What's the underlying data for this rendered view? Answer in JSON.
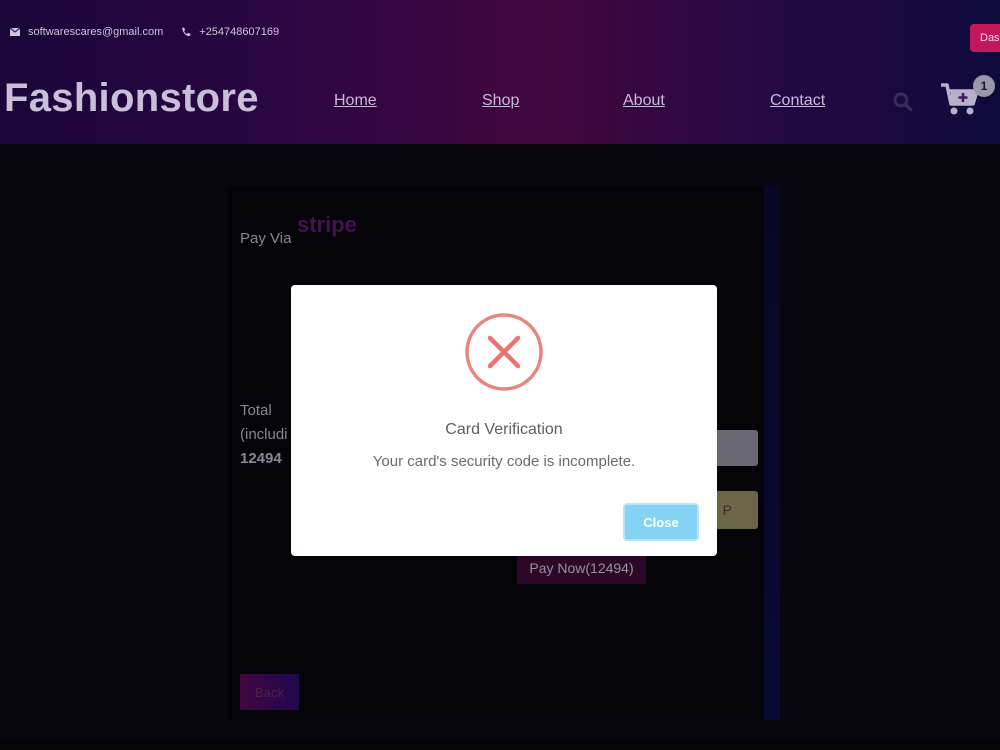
{
  "header": {
    "email": "softwarescares@gmail.com",
    "phone": "+254748607169",
    "dashboard_label": "Das",
    "logo": "Fashionstore",
    "nav": [
      "Home",
      "Shop",
      "About",
      "Contact"
    ],
    "cart_count": "1",
    "icons": [
      "envelope-icon",
      "phone-icon",
      "search-icon",
      "cart-icon"
    ]
  },
  "payment": {
    "pay_via": "Pay Via",
    "provider": "stripe",
    "total_label": "Total",
    "including": "(includi",
    "amount": "12494",
    "pay_field_fragment": "P",
    "pay_now": "Pay Now(12494)",
    "back": "Back"
  },
  "modal": {
    "title": "Card Verification",
    "message": "Your card's security code is incomplete.",
    "close": "Close",
    "icon": "error-x-icon",
    "accent": "#e8857e"
  }
}
